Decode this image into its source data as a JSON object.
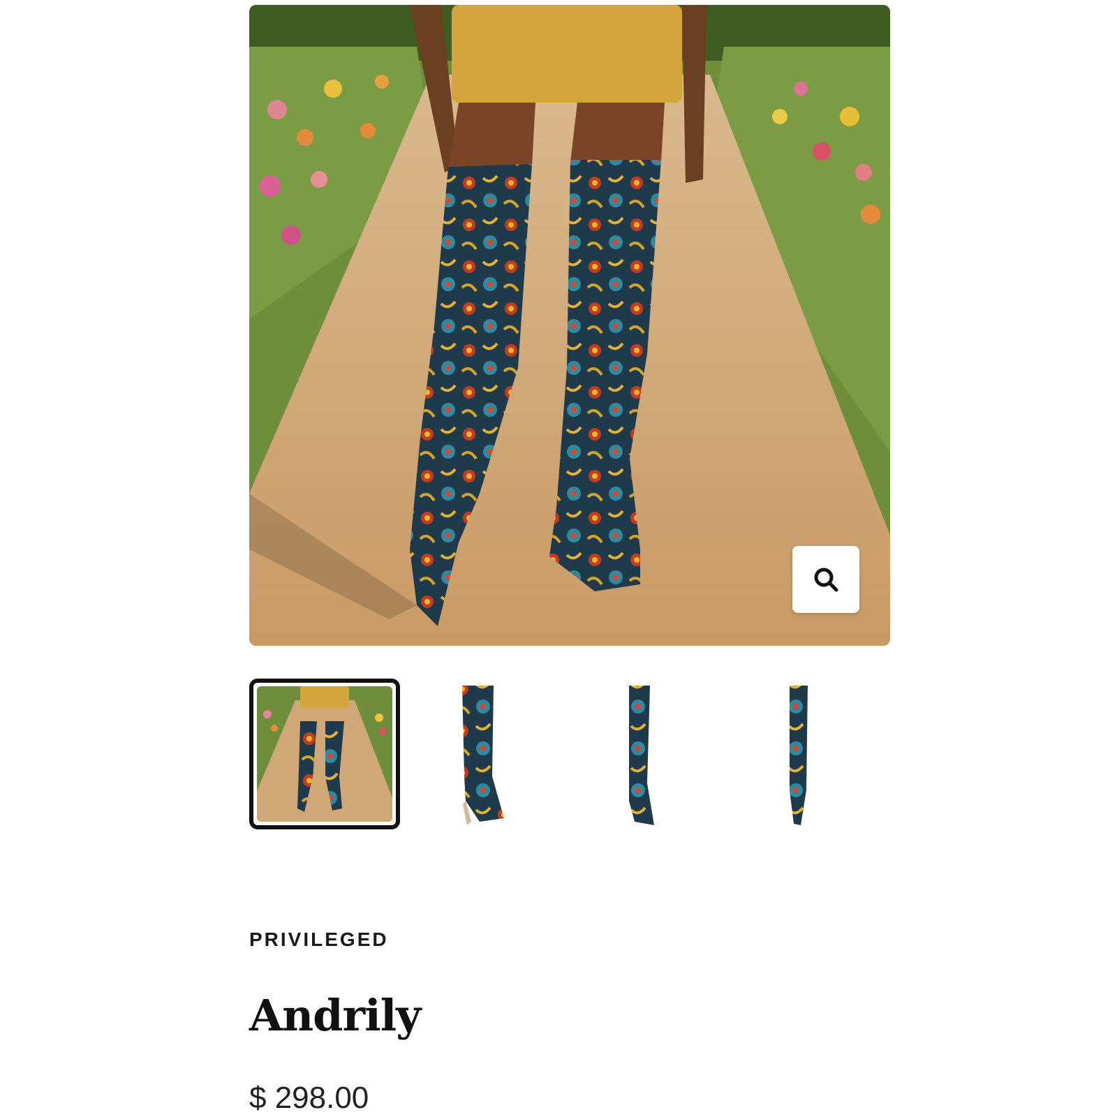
{
  "product": {
    "brand": "PRIVILEGED",
    "name": "Andrily",
    "price": "$ 298.00"
  },
  "gallery": {
    "zoom_icon": "search-icon",
    "selected_thumbnail": 1,
    "thumbnails": [
      {
        "view": "model-in-garden"
      },
      {
        "view": "boot-side"
      },
      {
        "view": "boot-angle"
      },
      {
        "view": "boot-front"
      }
    ]
  },
  "colors": {
    "text": "#111111",
    "active_border": "#111111"
  }
}
